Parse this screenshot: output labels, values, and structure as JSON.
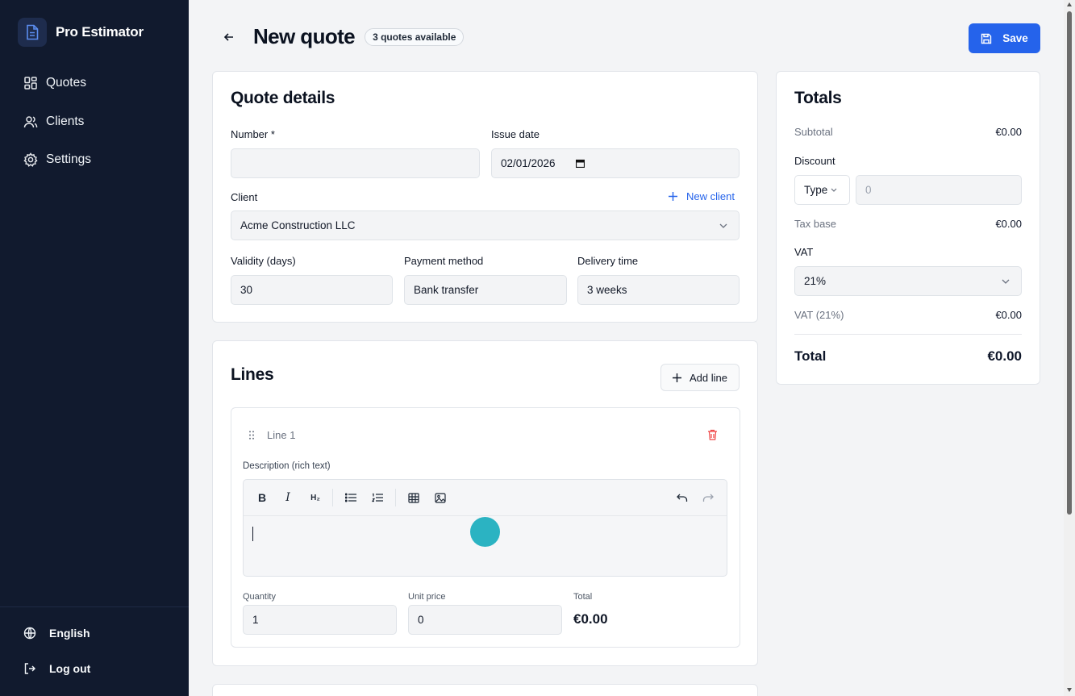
{
  "app": {
    "name": "Pro Estimator"
  },
  "nav": [
    {
      "label": "Quotes",
      "icon": "grid-icon"
    },
    {
      "label": "Clients",
      "icon": "users-icon"
    },
    {
      "label": "Settings",
      "icon": "gear-icon"
    }
  ],
  "footer": {
    "language": "English",
    "logout": "Log out"
  },
  "header": {
    "title": "New quote",
    "badge": "3 quotes available",
    "save_label": "Save"
  },
  "quote_details": {
    "title": "Quote details",
    "number_label": "Number *",
    "number_value": "",
    "issue_date_label": "Issue date",
    "issue_date_value": "02/01/2026",
    "client_label": "Client",
    "new_client_label": "New client",
    "client_value": "Acme Construction LLC",
    "validity_label": "Validity (days)",
    "validity_value": "30",
    "payment_label": "Payment method",
    "payment_value": "Bank transfer",
    "delivery_label": "Delivery time",
    "delivery_value": "3 weeks"
  },
  "lines": {
    "title": "Lines",
    "add_label": "Add line",
    "items": [
      {
        "name": "Line 1",
        "description_label": "Description (rich text)",
        "quantity_label": "Quantity",
        "quantity_value": "1",
        "unit_price_label": "Unit price",
        "unit_price_value": "0",
        "total_label": "Total",
        "total_value": "€0.00"
      }
    ]
  },
  "editor_toolbar": {
    "bold": "B",
    "italic": "I",
    "heading": "H₂"
  },
  "totals": {
    "title": "Totals",
    "subtotal_label": "Subtotal",
    "subtotal_value": "€0.00",
    "discount_label": "Discount",
    "discount_type": "Type",
    "discount_placeholder": "0",
    "tax_base_label": "Tax base",
    "tax_base_value": "€0.00",
    "vat_label": "VAT",
    "vat_value": "21%",
    "vat_amount_label": "VAT (21%)",
    "vat_amount_value": "€0.00",
    "total_label": "Total",
    "total_value": "€0.00"
  },
  "colors": {
    "sidebar": "#111a2e",
    "accent": "#2563eb",
    "danger": "#ef4444",
    "cursor": "#2bb3c2"
  }
}
